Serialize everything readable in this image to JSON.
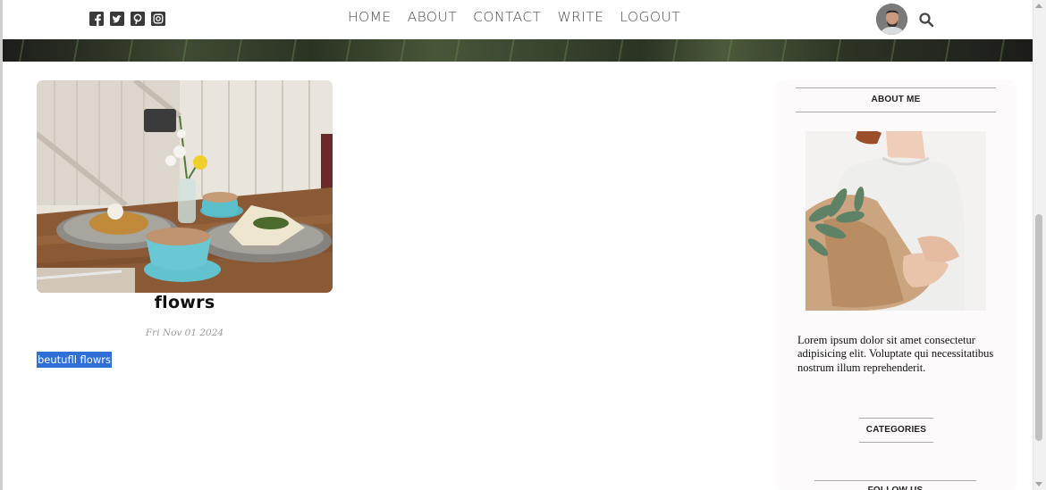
{
  "nav": {
    "social_icons": [
      "facebook-icon",
      "twitter-icon",
      "pinterest-icon",
      "instagram-icon"
    ],
    "links": [
      "HOME",
      "ABOUT",
      "CONTACT",
      "WRITE",
      "LOGOUT"
    ]
  },
  "post": {
    "title": "flowrs",
    "date": "Fri Nov 01 2024",
    "description": "beutufll flowrs"
  },
  "sidebar": {
    "about_title": "ABOUT ME",
    "about_text": "Lorem ipsum dolor sit amet consectetur adipisicing elit. Voluptate qui necessitatibus nostrum illum reprehenderit.",
    "categories_title": "CATEGORIES",
    "follow_title": "FOLLOW US"
  },
  "colors": {
    "nav_text": "#4c4c4c",
    "selection": "#2f6fd6",
    "sidebar_bg": "#fcfafa"
  }
}
